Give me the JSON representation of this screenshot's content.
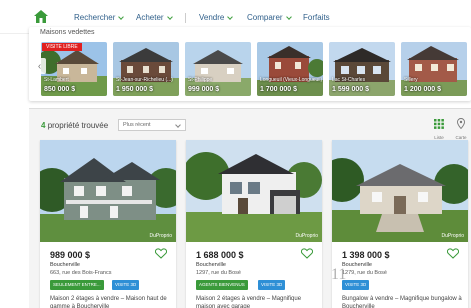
{
  "nav": {
    "items": [
      {
        "label": "Rechercher",
        "chevron": true
      },
      {
        "label": "Acheter",
        "chevron": true
      },
      {
        "label": "Vendre",
        "chevron": true
      },
      {
        "label": "Comparer",
        "chevron": true
      },
      {
        "label": "Forfaits",
        "chevron": false
      }
    ]
  },
  "recent": {
    "title": "Maisons vedettes",
    "tag": "VISITE LIBRE",
    "items": [
      {
        "location": "St-Lambert",
        "price": "850 000 $"
      },
      {
        "location": "St-Jean-sur-Richelieu (...)",
        "price": "1 950 000 $"
      },
      {
        "location": "St-Philippe",
        "price": "999 000 $"
      },
      {
        "location": "Longueuil (Vieux-Longueuil)",
        "price": "1 700 000 $"
      },
      {
        "location": "Lac St-Charles",
        "price": "1 599 000 $"
      },
      {
        "location": "Sillery",
        "price": "1 200 000 $"
      }
    ]
  },
  "results": {
    "count_number": "4",
    "count_text": "propriété trouvée",
    "sort_value": "Plus récent",
    "view_list_label": "Liste",
    "view_map_label": "Carte"
  },
  "listings": [
    {
      "price": "989 000 $",
      "city": "Boucherville",
      "address": "663, rue des Bois-Francs",
      "badge": "SEULEMENT ENTRE...",
      "visit": "VISITE 3D",
      "description": "Maison 2 étages à vendre – Maison haut de gamme à Boucherville",
      "watermark": "DuProprio"
    },
    {
      "price": "1 688 000 $",
      "city": "Boucherville",
      "address": "1297, rue du Bosé",
      "badge": "AGENTS BIENVENUS",
      "visit": "VISITE 3D",
      "description": "Maison 2 étages à vendre – Magnifique maison avec garage",
      "watermark": "DuProprio"
    },
    {
      "price": "1 398 000 $",
      "city": "Boucherville",
      "address": "1279, rue du Bosé",
      "badge": "",
      "visit": "VISITE 3D",
      "description": "Bungalow à vendre – Magnifique bungalow à Boucherville",
      "watermark": "DuProprio"
    }
  ],
  "page_marker": "11",
  "colors": {
    "accent": "#3a9a3a",
    "nav_text": "#2f5f8a",
    "visit_button": "#2e8fd6",
    "tag_red": "#e02020"
  }
}
